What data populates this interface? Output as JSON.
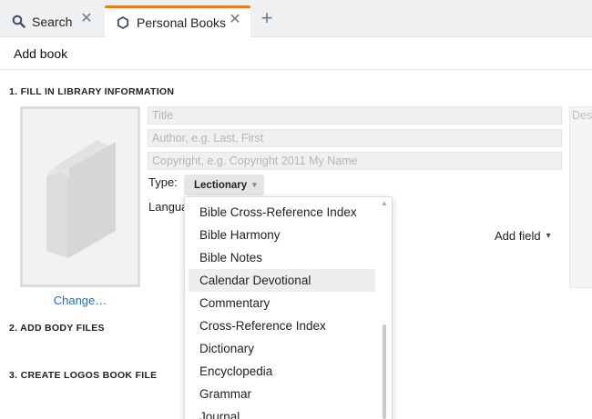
{
  "tabs": [
    {
      "label": "Search",
      "icon": "search-icon"
    },
    {
      "label": "Personal Books",
      "icon": "hexagon-icon",
      "active": true,
      "accent": "#ee7c1e"
    }
  ],
  "panel": {
    "title": "Add book"
  },
  "sections": {
    "s1": "1. FILL IN LIBRARY INFORMATION",
    "s2": "2. ADD BODY FILES",
    "s3": "3. CREATE LOGOS BOOK FILE"
  },
  "cover": {
    "change_label": "Change…"
  },
  "fields": {
    "title_placeholder": "Title",
    "author_placeholder": "Author, e.g. Last, First",
    "copyright_placeholder": "Copyright, e.g. Copyright 2011 My Name",
    "description_placeholder": "Des"
  },
  "type": {
    "label": "Type:",
    "selected": "Lectionary"
  },
  "language": {
    "label": "Language:"
  },
  "add_field": {
    "label": "Add field"
  },
  "dropdown": {
    "items": [
      "Bible Cross-Reference Index",
      "Bible Harmony",
      "Bible Notes",
      "Calendar Devotional",
      "Commentary",
      "Cross-Reference Index",
      "Dictionary",
      "Encyclopedia",
      "Grammar",
      "Journal"
    ],
    "highlighted": "Calendar Devotional"
  },
  "colors": {
    "link": "#2a6eb8",
    "accent": "#ee7c1e",
    "highlight": "#eeeeee"
  }
}
